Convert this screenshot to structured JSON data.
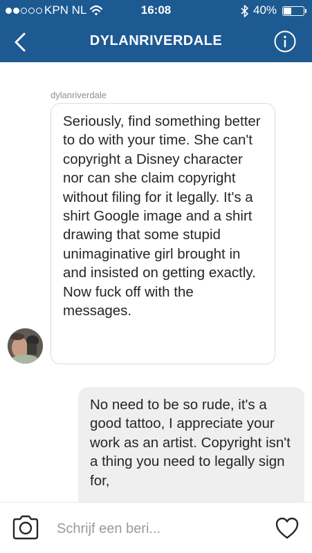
{
  "status_bar": {
    "signal_filled_dots": 2,
    "signal_total_dots": 5,
    "carrier": "KPN NL",
    "wifi_icon": "wifi-icon",
    "time": "16:08",
    "bluetooth_icon": "bluetooth-icon",
    "battery_percent_label": "40%",
    "battery_level": 0.4
  },
  "header": {
    "back_icon": "chevron-left-icon",
    "title": "DYLANRIVERDALE",
    "info_icon": "info-circle-icon",
    "background_color": "#1d5a92"
  },
  "messages": [
    {
      "direction": "incoming",
      "sender": "dylanriverdale",
      "text": "Seriously, find something better to do with your time. She can't copyright a Disney character nor can she claim copyright without filing for it legally. It's a shirt Google image and a shirt drawing that some stupid unimaginative girl brought in and insisted on getting exactly. Now fuck off with the messages."
    },
    {
      "direction": "outgoing",
      "text": "No need to be so rude, it's a good tattoo, I appreciate your work as an artist. Copyright isn't a thing you need to legally sign for,"
    }
  ],
  "composer": {
    "camera_icon": "camera-icon",
    "placeholder": "Schrijf een beri...",
    "heart_icon": "heart-icon"
  }
}
